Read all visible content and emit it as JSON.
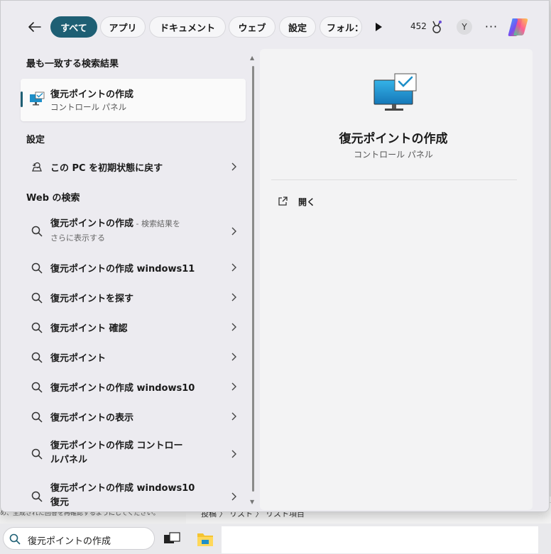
{
  "filters": {
    "chips": [
      "すべて",
      "アプリ",
      "ドキュメント",
      "ウェブ",
      "設定",
      "フォル："
    ],
    "points": "452",
    "avatar": "Y",
    "more": "···"
  },
  "results": {
    "best_match_header": "最も一致する検索結果",
    "best_match": {
      "title": "復元ポイントの作成",
      "subtitle": "コントロール パネル"
    },
    "settings_header": "設定",
    "settings_item": "この PC を初期状態に戻す",
    "web_header": "Web の検索",
    "web_first": {
      "title": "復元ポイントの作成",
      "suffix": " - 検索結果を",
      "suffix2": "さらに表示する"
    },
    "web_items": [
      "復元ポイントの作成 windows11",
      "復元ポイントを探す",
      "復元ポイント 確認",
      "復元ポイント",
      "復元ポイントの作成 windows10",
      "復元ポイントの表示"
    ],
    "web_multi": [
      {
        "line1": "復元ポイントの作成 コントロー",
        "line2": "ルパネル"
      },
      {
        "line1": "復元ポイントの作成 windows10",
        "line2": "復元"
      }
    ]
  },
  "preview": {
    "title": "復元ポイントの作成",
    "subtitle": "コントロール パネル",
    "open_label": "開く"
  },
  "background": {
    "left_text": "め、生成された回答を再確認するようにしてください。",
    "crumb": "投稿 〉 リスト 〉 リスト項目"
  },
  "taskbar": {
    "search_value": "復元ポイントの作成"
  },
  "colors": {
    "accent": "#1e5f74"
  }
}
